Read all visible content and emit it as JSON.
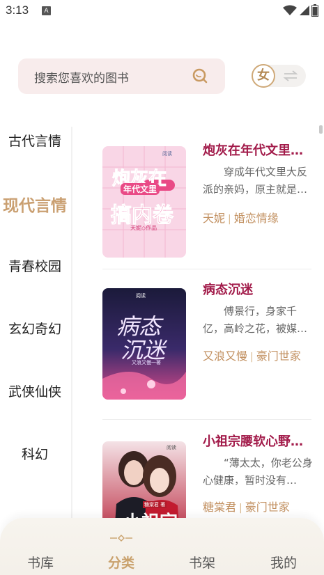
{
  "status_bar": {
    "time": "3:13",
    "badge": "A",
    "icons": [
      "wifi-icon",
      "cellular-icon",
      "battery-icon"
    ]
  },
  "search": {
    "placeholder": "搜索您喜欢的图书",
    "icon": "search-icon"
  },
  "gender_toggle": {
    "selected_label": "女",
    "icon": "swap-icon"
  },
  "categories": [
    {
      "label": "古代言情",
      "active": false
    },
    {
      "label": "现代言情",
      "active": true
    },
    {
      "label": "青春校园",
      "active": false
    },
    {
      "label": "玄幻奇幻",
      "active": false
    },
    {
      "label": "武侠仙侠",
      "active": false
    },
    {
      "label": "科幻",
      "active": false
    }
  ],
  "books": [
    {
      "title": "炮灰在年代文里…",
      "description": "穿成年代文里大反派的亲妈，原主就是…",
      "author": "天妮",
      "genre": "婚恋情缘",
      "cover": {
        "title_lines": [
          "炮灰在",
          "年代文里",
          "搞内卷"
        ],
        "byline": "天妮◇作品",
        "publisher": "阅读"
      }
    },
    {
      "title": "病态沉迷",
      "description": "傅景行，身家千亿，高岭之花，被媒…",
      "author": "又浪又慢",
      "genre": "豪门世家",
      "cover": {
        "title_lines": [
          "病态",
          "沉迷"
        ],
        "byline": "又浪又慢一著",
        "publisher": "阅读"
      }
    },
    {
      "title": "小祖宗腰软心野…",
      "description": "“薄太太，你老公身心健康，暂时没有…",
      "author": "糖棠君",
      "genre": "豪门世家",
      "cover": {
        "title_lines": [
          "糖棠君 著",
          "小祖宗"
        ],
        "byline": "",
        "publisher": "阅读"
      }
    }
  ],
  "tabbar": {
    "tabs": [
      {
        "label": "书库",
        "active": false
      },
      {
        "label": "分类",
        "active": true
      },
      {
        "label": "书架",
        "active": false
      },
      {
        "label": "我的",
        "active": false
      }
    ]
  },
  "colors": {
    "accent": "#caa072",
    "title": "#a21b4a",
    "tag": "#c29060",
    "search_bg": "#f8ecec"
  }
}
